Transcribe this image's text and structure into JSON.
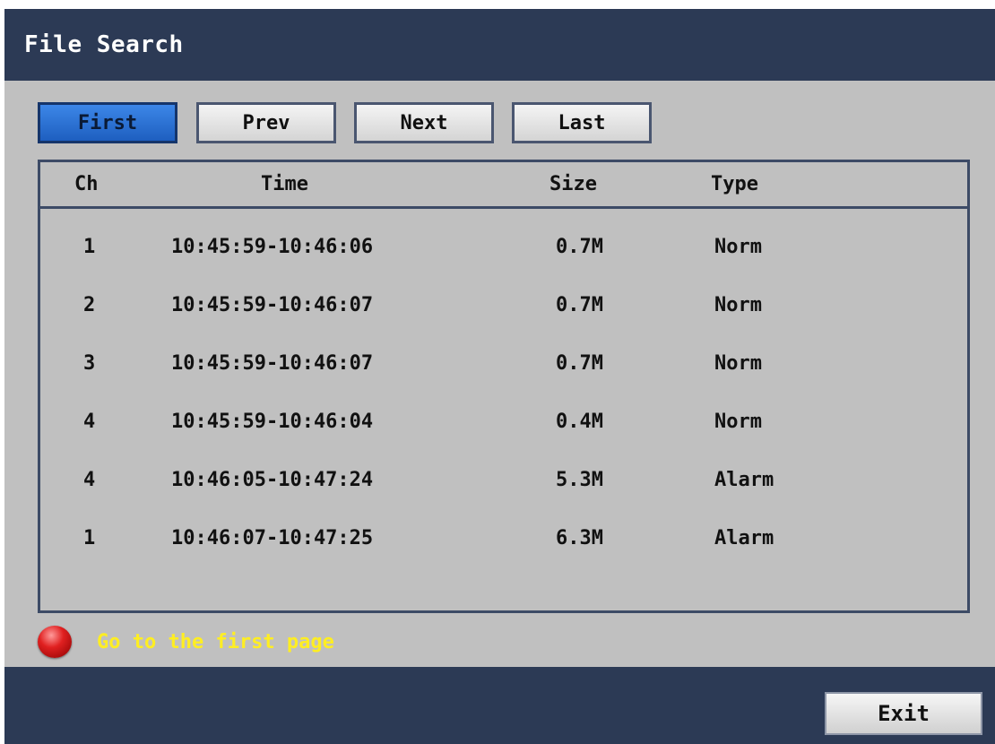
{
  "window": {
    "title": "File Search"
  },
  "nav_buttons": [
    {
      "label": "First",
      "active": true
    },
    {
      "label": "Prev",
      "active": false
    },
    {
      "label": "Next",
      "active": false
    },
    {
      "label": "Last",
      "active": false
    }
  ],
  "table": {
    "columns": [
      "Ch",
      "Time",
      "Size",
      "Type"
    ],
    "rows": [
      {
        "ch": "1",
        "time": "10:45:59-10:46:06",
        "size": "0.7M",
        "type": "Norm"
      },
      {
        "ch": "2",
        "time": "10:45:59-10:46:07",
        "size": "0.7M",
        "type": "Norm"
      },
      {
        "ch": "3",
        "time": "10:45:59-10:46:07",
        "size": "0.7M",
        "type": "Norm"
      },
      {
        "ch": "4",
        "time": "10:45:59-10:46:04",
        "size": "0.4M",
        "type": "Norm"
      },
      {
        "ch": "4",
        "time": "10:46:05-10:47:24",
        "size": "5.3M",
        "type": "Alarm"
      },
      {
        "ch": "1",
        "time": "10:46:07-10:47:25",
        "size": "6.3M",
        "type": "Alarm"
      }
    ]
  },
  "status": {
    "icon": "red-led-icon",
    "message": "Go to the first page"
  },
  "footer": {
    "exit_label": "Exit"
  },
  "colors": {
    "bar": "#2c3a55",
    "panel": "#c0c0c0",
    "active_button": "#2f74d8",
    "status_text": "#ffee22"
  }
}
